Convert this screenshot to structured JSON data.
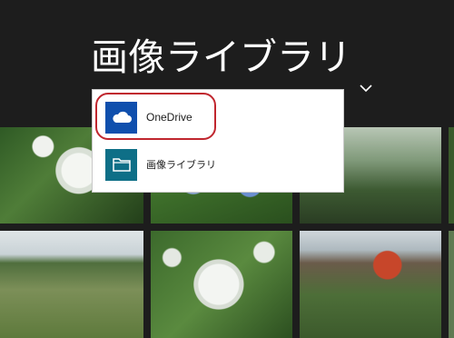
{
  "header": {
    "title": "画像ライブラリ",
    "title_icon": "chevron-down-icon"
  },
  "dropdown": {
    "items": [
      {
        "label": "OneDrive",
        "icon": "cloud-icon",
        "icon_color": "#0f4fad"
      },
      {
        "label": "画像ライブラリ",
        "icon": "folder-icon",
        "icon_color": "#0e6f87"
      }
    ],
    "highlight_color": "#c0262e"
  },
  "grid": {
    "tiles": [
      "hydrangea",
      "hydrangea-blue",
      "temple-garden",
      "iris-field",
      "hydrangea-white",
      "temple-maple"
    ]
  }
}
